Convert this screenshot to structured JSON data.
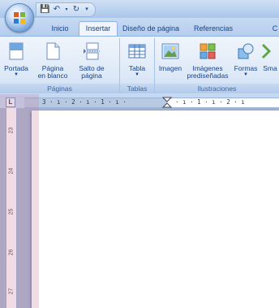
{
  "tabs": [
    "Inicio",
    "Insertar",
    "Diseño de página",
    "Referencias",
    "C"
  ],
  "active_tab": "Insertar",
  "quick_access": [
    "save-icon",
    "undo-icon",
    "redo-icon",
    "customize-icon"
  ],
  "ribbon": {
    "groups": [
      {
        "label": "Páginas",
        "commands": [
          {
            "line1": "Portada",
            "line2": "",
            "dropdown": true,
            "icon": "cover-page-icon"
          },
          {
            "line1": "Página",
            "line2": "en blanco",
            "dropdown": false,
            "icon": "blank-page-icon"
          },
          {
            "line1": "Salto de",
            "line2": "página",
            "dropdown": false,
            "icon": "page-break-icon"
          }
        ]
      },
      {
        "label": "Tablas",
        "commands": [
          {
            "line1": "Tabla",
            "line2": "",
            "dropdown": true,
            "icon": "table-icon"
          }
        ]
      },
      {
        "label": "Ilustraciones",
        "commands": [
          {
            "line1": "Imagen",
            "line2": "",
            "dropdown": false,
            "icon": "picture-icon"
          },
          {
            "line1": "Imágenes",
            "line2": "prediseñadas",
            "dropdown": false,
            "icon": "clipart-icon"
          },
          {
            "line1": "Formas",
            "line2": "",
            "dropdown": true,
            "icon": "shapes-icon"
          },
          {
            "line1": "Sma",
            "line2": "",
            "dropdown": false,
            "icon": "smartart-icon"
          }
        ]
      }
    ]
  },
  "ruler": {
    "corner": "L",
    "horizontal_text": "3 · ı · 2 · ı · 1 · ı ·",
    "horizontal_text_right": "· ı · 1 · ı · 2 · ı",
    "vertical_marks": [
      "23",
      "24",
      "25",
      "26",
      "27"
    ]
  }
}
